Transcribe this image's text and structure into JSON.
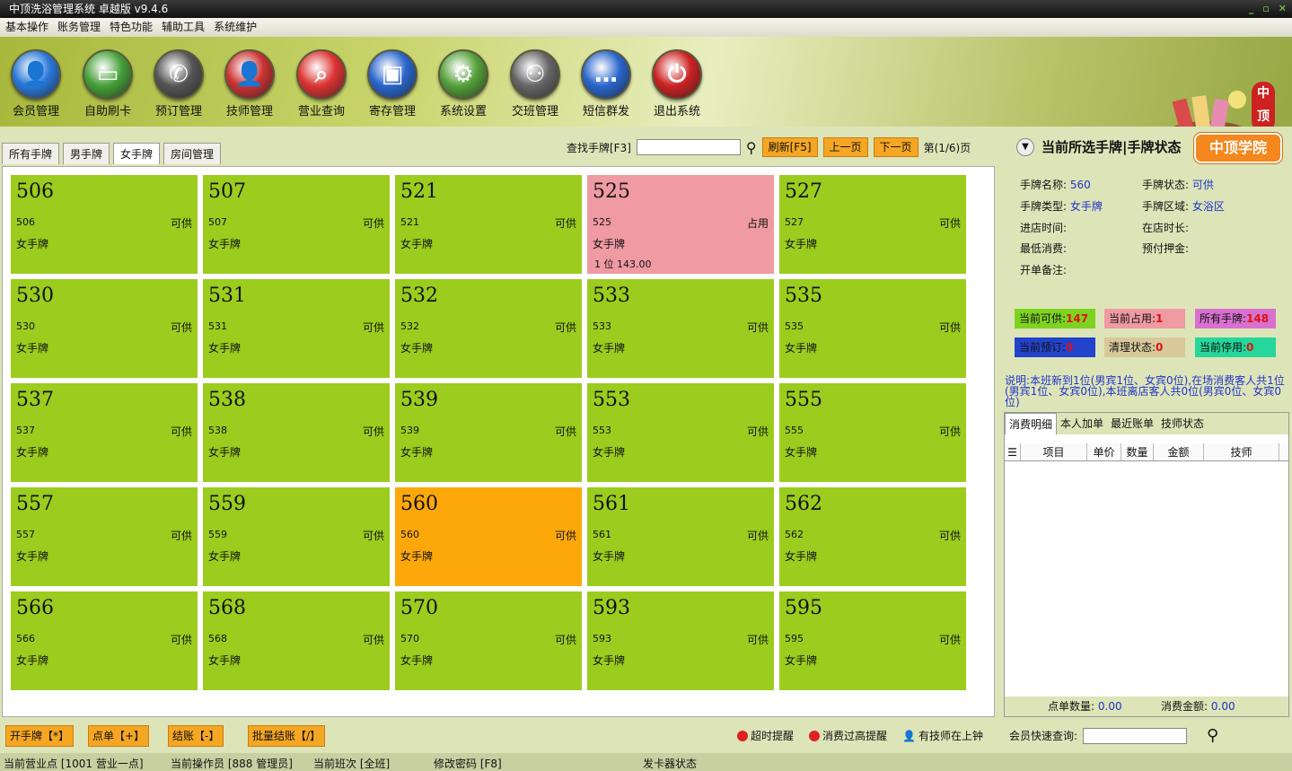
{
  "window": {
    "title": "中顶洗浴管理系统 卓越版 v9.4.6",
    "controls": [
      "_",
      "▫",
      "✕"
    ]
  },
  "menu": [
    "基本操作",
    "账务管理",
    "特色功能",
    "辅助工具",
    "系统维护"
  ],
  "toolbar": [
    {
      "label": "会员管理",
      "icon": "person-icon",
      "color": "#2a78d8",
      "glyph": "👤"
    },
    {
      "label": "自助刷卡",
      "icon": "card-icon",
      "color": "#46a03a",
      "glyph": "▭"
    },
    {
      "label": "预订管理",
      "icon": "phone-icon",
      "color": "#555555",
      "glyph": "✆"
    },
    {
      "label": "技师管理",
      "icon": "person-icon",
      "color": "#cc3333",
      "glyph": "👤"
    },
    {
      "label": "营业查询",
      "icon": "magnifier-icon",
      "color": "#dd3333",
      "glyph": "⌕"
    },
    {
      "label": "寄存管理",
      "icon": "bag-icon",
      "color": "#2a66cc",
      "glyph": "▣"
    },
    {
      "label": "系统设置",
      "icon": "gear-icon",
      "color": "#55a03a",
      "glyph": "⚙"
    },
    {
      "label": "交班管理",
      "icon": "group-icon",
      "color": "#666666",
      "glyph": "⚇"
    },
    {
      "label": "短信群发",
      "icon": "chat-icon",
      "color": "#2a66cc",
      "glyph": "…"
    },
    {
      "label": "退出系统",
      "icon": "power-icon",
      "color": "#cc2222",
      "glyph": "⏻"
    }
  ],
  "brand_badge": "中顶",
  "tabs": [
    "所有手牌",
    "男手牌",
    "女手牌",
    "房间管理"
  ],
  "active_tab": 2,
  "search": {
    "label": "查找手牌[F3]",
    "value": "",
    "refresh": "刷新[F5]",
    "prev": "上一页",
    "next": "下一页",
    "page": "第(1/6)页"
  },
  "cards": [
    {
      "num": "506",
      "sub": "506",
      "status": "可供",
      "type": "女手牌",
      "state": "free"
    },
    {
      "num": "507",
      "sub": "507",
      "status": "可供",
      "type": "女手牌",
      "state": "free"
    },
    {
      "num": "521",
      "sub": "521",
      "status": "可供",
      "type": "女手牌",
      "state": "free"
    },
    {
      "num": "525",
      "sub": "525",
      "status": "占用",
      "type": "女手牌",
      "state": "occupied",
      "extra": "1 位     143.00"
    },
    {
      "num": "527",
      "sub": "527",
      "status": "可供",
      "type": "女手牌",
      "state": "free"
    },
    {
      "num": "530",
      "sub": "530",
      "status": "可供",
      "type": "女手牌",
      "state": "free"
    },
    {
      "num": "531",
      "sub": "531",
      "status": "可供",
      "type": "女手牌",
      "state": "free"
    },
    {
      "num": "532",
      "sub": "532",
      "status": "可供",
      "type": "女手牌",
      "state": "free"
    },
    {
      "num": "533",
      "sub": "533",
      "status": "可供",
      "type": "女手牌",
      "state": "free"
    },
    {
      "num": "535",
      "sub": "535",
      "status": "可供",
      "type": "女手牌",
      "state": "free"
    },
    {
      "num": "537",
      "sub": "537",
      "status": "可供",
      "type": "女手牌",
      "state": "free"
    },
    {
      "num": "538",
      "sub": "538",
      "status": "可供",
      "type": "女手牌",
      "state": "free"
    },
    {
      "num": "539",
      "sub": "539",
      "status": "可供",
      "type": "女手牌",
      "state": "free"
    },
    {
      "num": "553",
      "sub": "553",
      "status": "可供",
      "type": "女手牌",
      "state": "free"
    },
    {
      "num": "555",
      "sub": "555",
      "status": "可供",
      "type": "女手牌",
      "state": "free"
    },
    {
      "num": "557",
      "sub": "557",
      "status": "可供",
      "type": "女手牌",
      "state": "free"
    },
    {
      "num": "559",
      "sub": "559",
      "status": "可供",
      "type": "女手牌",
      "state": "free"
    },
    {
      "num": "560",
      "sub": "560",
      "status": "可供",
      "type": "女手牌",
      "state": "selected"
    },
    {
      "num": "561",
      "sub": "561",
      "status": "可供",
      "type": "女手牌",
      "state": "free"
    },
    {
      "num": "562",
      "sub": "562",
      "status": "可供",
      "type": "女手牌",
      "state": "free"
    },
    {
      "num": "566",
      "sub": "566",
      "status": "可供",
      "type": "女手牌",
      "state": "free"
    },
    {
      "num": "568",
      "sub": "568",
      "status": "可供",
      "type": "女手牌",
      "state": "free"
    },
    {
      "num": "570",
      "sub": "570",
      "status": "可供",
      "type": "女手牌",
      "state": "free"
    },
    {
      "num": "593",
      "sub": "593",
      "status": "可供",
      "type": "女手牌",
      "state": "free"
    },
    {
      "num": "595",
      "sub": "595",
      "status": "可供",
      "type": "女手牌",
      "state": "free"
    }
  ],
  "bottom_buttons": [
    "开手牌【*】",
    "点单【+】",
    "结账【-】",
    "批量结账【/】"
  ],
  "alerts": [
    "超时提醒",
    "消费过高提醒",
    "有技师在上钟"
  ],
  "right": {
    "title": "当前所选手牌|手牌状态",
    "school": "中顶学院",
    "info": {
      "name_label": "手牌名称:",
      "name": "560",
      "state_label": "手牌状态:",
      "state": "可供",
      "type_label": "手牌类型:",
      "type": "女手牌",
      "area_label": "手牌区域:",
      "area": "女浴区",
      "checkin_label": "进店时间:",
      "checkin": "",
      "duration_label": "在店时长:",
      "duration": "",
      "min_label": "最低消费:",
      "min": "",
      "deposit_label": "预付押金:",
      "deposit": "",
      "remark_label": "开单备注:",
      "remark": ""
    },
    "stats": [
      {
        "label": "当前可供:",
        "value": "147",
        "color": "#7ed321"
      },
      {
        "label": "当前占用:",
        "value": "1",
        "color": "#f09aa3"
      },
      {
        "label": "所有手牌:",
        "value": "148",
        "color": "#d870d0"
      },
      {
        "label": "当前预订:",
        "value": "0",
        "color": "#2244cc"
      },
      {
        "label": "清理状态:",
        "value": "0",
        "color": "#d8c89a"
      },
      {
        "label": "当前停用:",
        "value": "0",
        "color": "#26d69a"
      }
    ],
    "note": "说明:本班新到1位(男宾1位、女宾0位),在场消费客人共1位(男宾1位、女宾0位),本班离店客人共0位(男宾0位、女宾0位)",
    "subtabs": [
      "消费明细",
      "本人加单",
      "最近账单",
      "技师状态"
    ],
    "columns": [
      "项目",
      "单价",
      "数量",
      "金额",
      "技师"
    ],
    "summary": {
      "count_label": "点单数量:",
      "count": "0.00",
      "amount_label": "消费金额:",
      "amount": "0.00"
    },
    "quick_label": "会员快速查询:"
  },
  "statusbar": [
    "当前营业点 [1001 营业一点]",
    "当前操作员 [888 管理员]",
    "当前班次 [全班]",
    "修改密码 [F8]",
    "发卡器状态"
  ]
}
